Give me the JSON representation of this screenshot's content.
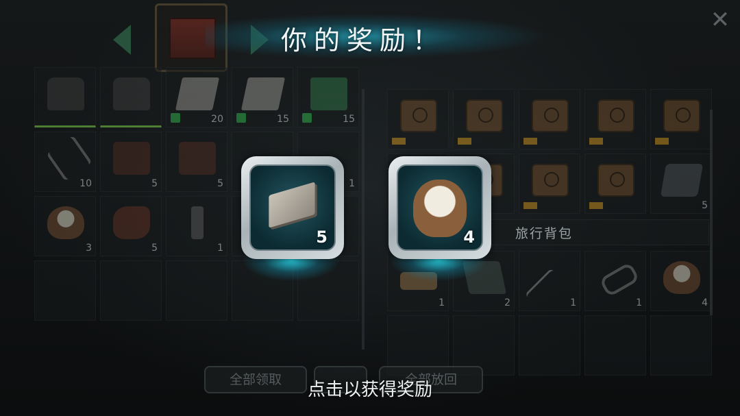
{
  "header": {
    "title": "你的奖励！",
    "prev_icon": "chevron-left-icon",
    "next_icon": "chevron-right-icon",
    "chest_icon": "red-crate-icon",
    "close_icon": "close-icon"
  },
  "left_grid": [
    {
      "icon": "boots",
      "count": "",
      "green": true
    },
    {
      "icon": "boots",
      "count": "",
      "green": true
    },
    {
      "icon": "paper",
      "count": "20",
      "badge": "medkit"
    },
    {
      "icon": "paper",
      "count": "15",
      "badge": "medkit"
    },
    {
      "icon": "herb",
      "count": "15",
      "badge": "medkit"
    },
    {
      "icon": "shears",
      "count": "10"
    },
    {
      "icon": "box",
      "count": "5"
    },
    {
      "icon": "box",
      "count": "5"
    },
    {
      "icon": "",
      "count": ""
    },
    {
      "icon": "",
      "count": "1"
    },
    {
      "icon": "cotton",
      "count": "3"
    },
    {
      "icon": "leather",
      "count": "5"
    },
    {
      "icon": "bolt",
      "count": "1"
    },
    {
      "icon": "",
      "count": ""
    },
    {
      "icon": "",
      "count": ""
    },
    {
      "icon": "",
      "count": ""
    },
    {
      "icon": "",
      "count": ""
    },
    {
      "icon": "",
      "count": ""
    },
    {
      "icon": "",
      "count": ""
    },
    {
      "icon": "",
      "count": ""
    }
  ],
  "right_grid_top": [
    {
      "icon": "crate",
      "count": "",
      "gold": true
    },
    {
      "icon": "crate",
      "count": "",
      "gold": true
    },
    {
      "icon": "crate",
      "count": "",
      "gold": true
    },
    {
      "icon": "crate",
      "count": "",
      "gold": true
    },
    {
      "icon": "crate",
      "count": "",
      "gold": true
    },
    {
      "icon": "",
      "count": ""
    },
    {
      "icon": "crate",
      "count": "",
      "gold": true
    },
    {
      "icon": "crate",
      "count": "",
      "gold": true
    },
    {
      "icon": "crate",
      "count": "",
      "gold": true
    },
    {
      "icon": "slab",
      "count": "5"
    }
  ],
  "bag_label": "旅行背包",
  "right_grid_bottom": [
    {
      "icon": "brick",
      "count": "1"
    },
    {
      "icon": "cloth",
      "count": "2"
    },
    {
      "icon": "rod",
      "count": "1"
    },
    {
      "icon": "chain",
      "count": "1"
    },
    {
      "icon": "cotton",
      "count": "4"
    },
    {
      "icon": "",
      "count": ""
    },
    {
      "icon": "",
      "count": ""
    },
    {
      "icon": "",
      "count": ""
    },
    {
      "icon": "",
      "count": ""
    },
    {
      "icon": "",
      "count": ""
    }
  ],
  "rewards": [
    {
      "name": "iron-plate",
      "qty": "5"
    },
    {
      "name": "cotton",
      "qty": "4"
    }
  ],
  "buttons": {
    "take_all": "全部领取",
    "return_all": "全部放回"
  },
  "hint": "点击以获得奖励",
  "colors": {
    "accent_cyan": "#28dcf0",
    "green": "#7fd04a",
    "gold": "#c48e1d"
  }
}
